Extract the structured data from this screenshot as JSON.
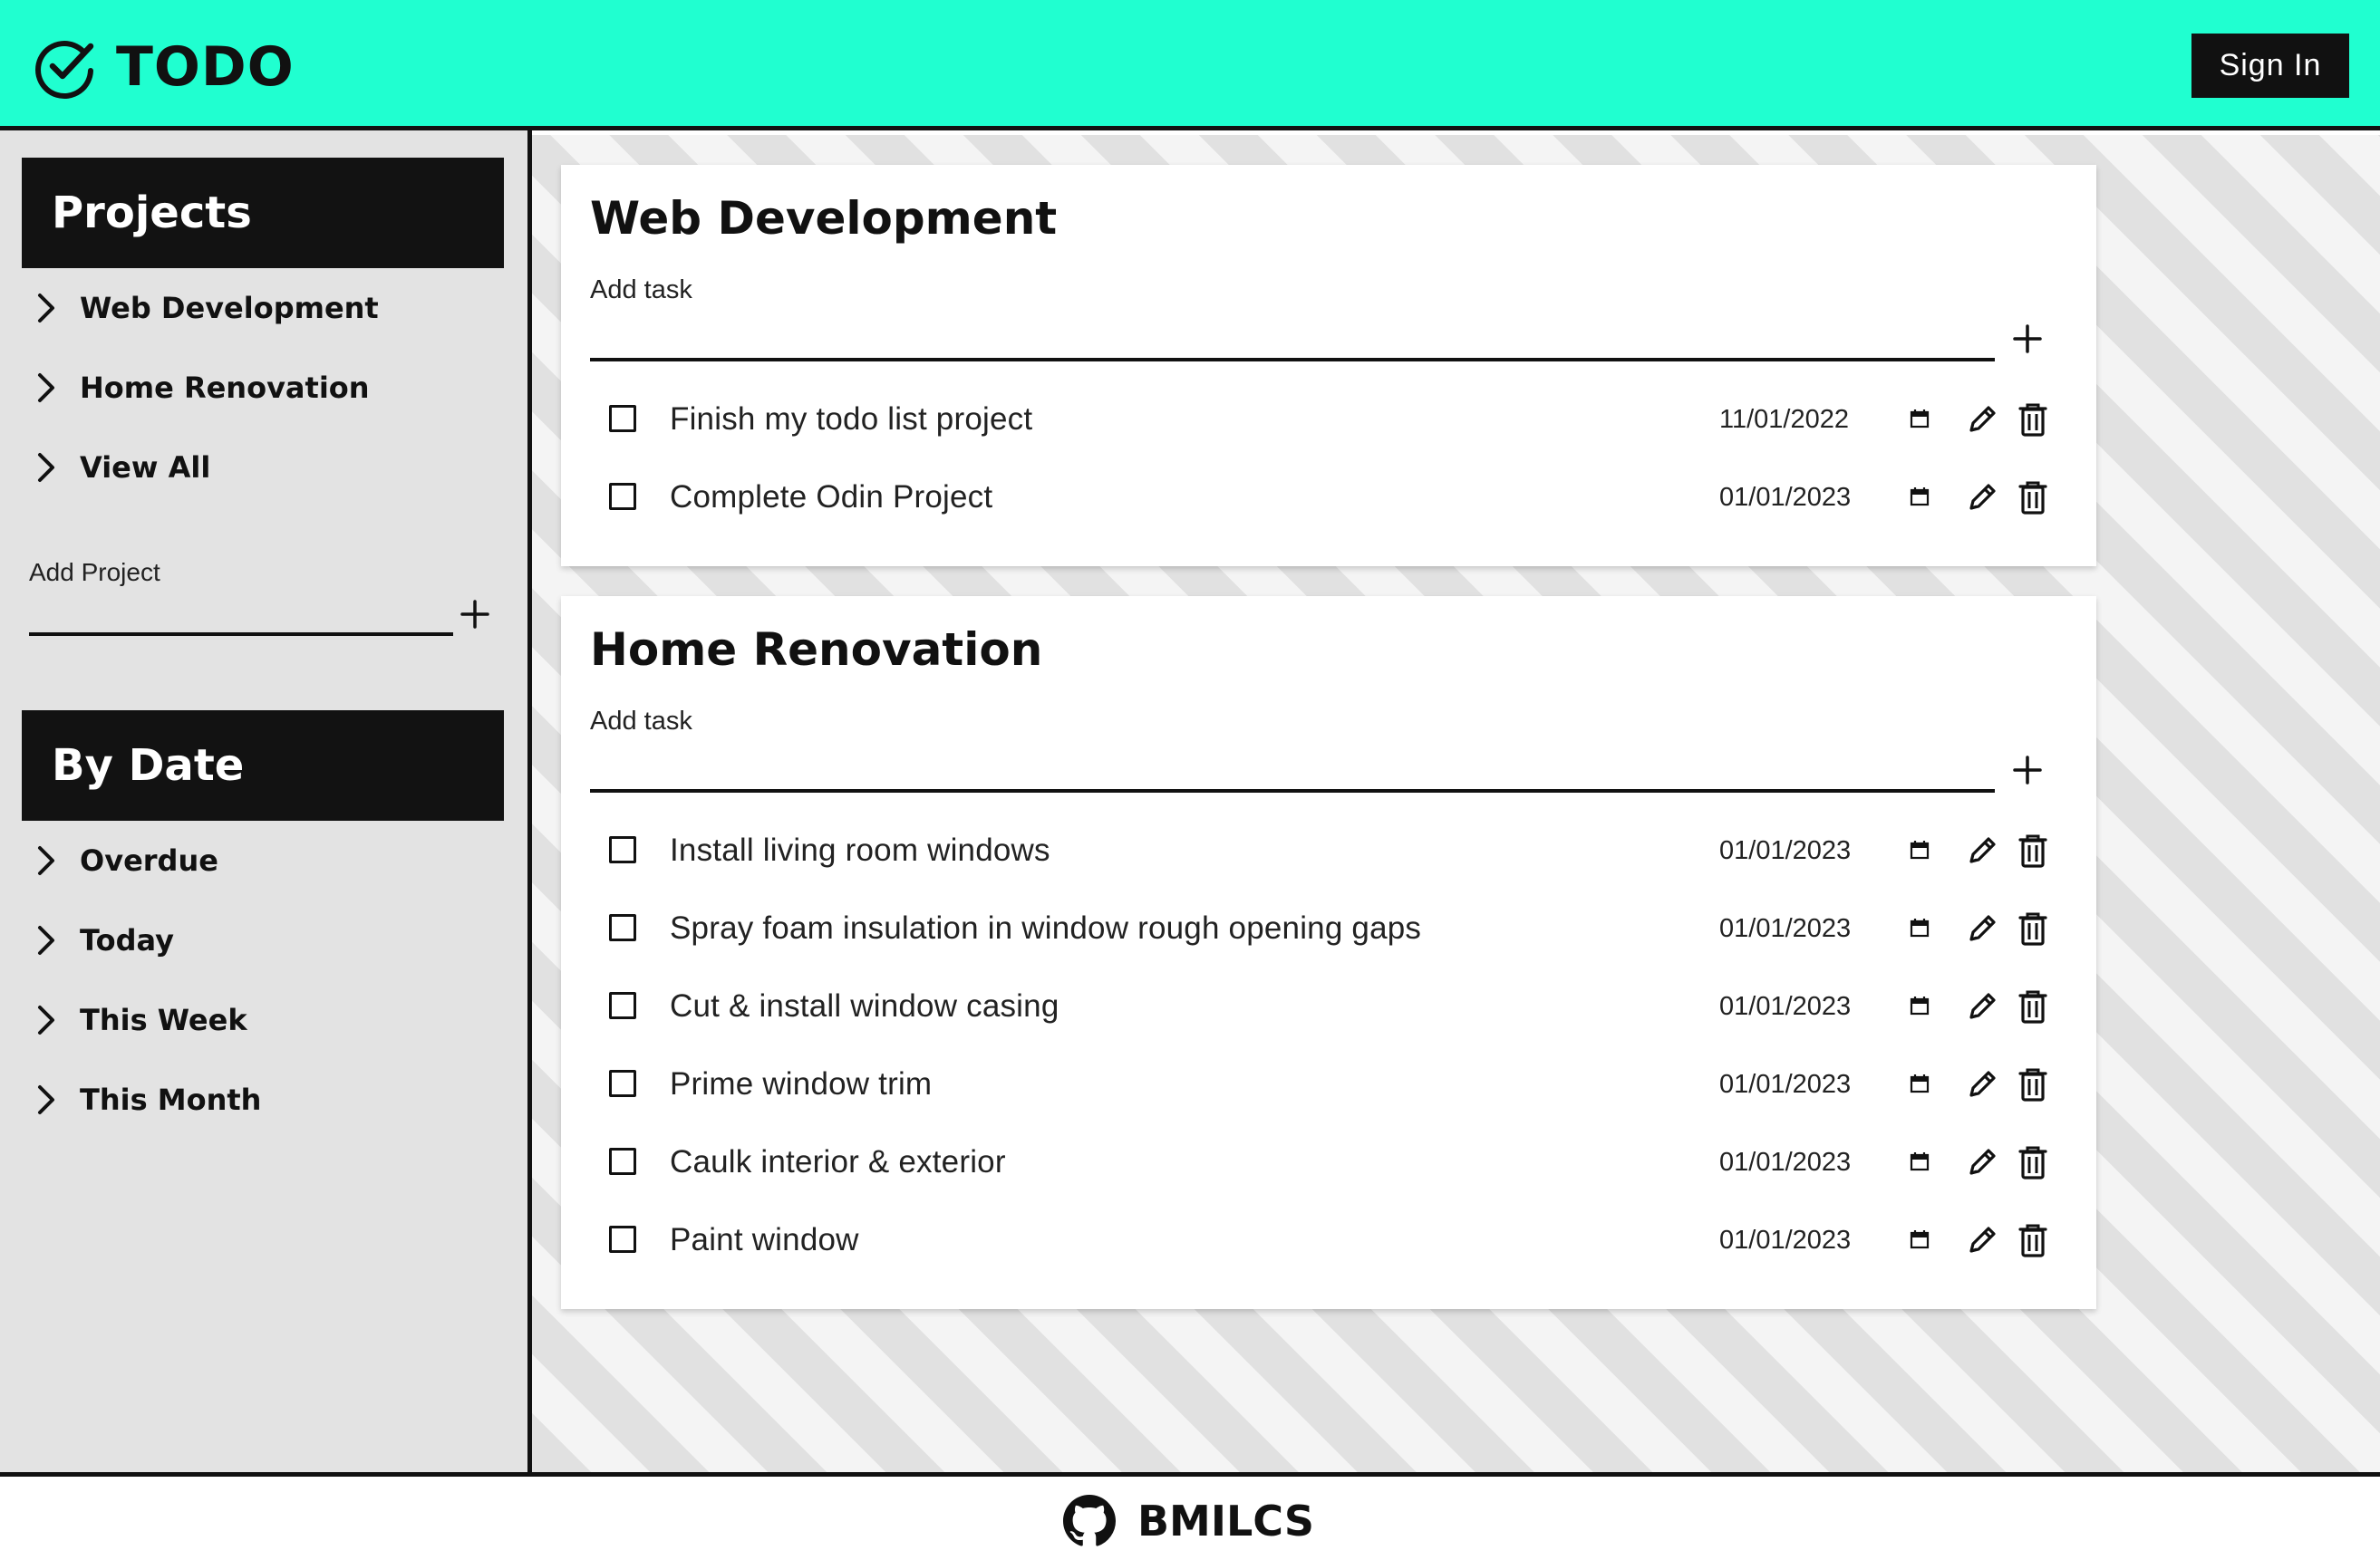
{
  "header": {
    "app_name": "TODO",
    "logo_icon": "check-circle-icon",
    "sign_in_label": "Sign In",
    "accent_color": "#20ffd0"
  },
  "sidebar": {
    "projects_heading": "Projects",
    "project_items": [
      {
        "label": "Web Development",
        "icon": "chevron-right-icon"
      },
      {
        "label": "Home Renovation",
        "icon": "chevron-right-icon"
      },
      {
        "label": "View All",
        "icon": "chevron-right-icon"
      }
    ],
    "add_project_label": "Add Project",
    "add_project_value": "",
    "by_date_heading": "By Date",
    "date_items": [
      {
        "label": "Overdue",
        "icon": "chevron-right-icon"
      },
      {
        "label": "Today",
        "icon": "chevron-right-icon"
      },
      {
        "label": "This Week",
        "icon": "chevron-right-icon"
      },
      {
        "label": "This Month",
        "icon": "chevron-right-icon"
      }
    ]
  },
  "projects": [
    {
      "title": "Web Development",
      "add_task_label": "Add task",
      "add_task_value": "",
      "tasks": [
        {
          "text": "Finish my todo list project",
          "date": "11/01/2022",
          "done": false
        },
        {
          "text": "Complete Odin Project",
          "date": "01/01/2023",
          "done": false
        }
      ]
    },
    {
      "title": "Home Renovation",
      "add_task_label": "Add task",
      "add_task_value": "",
      "tasks": [
        {
          "text": "Install living room windows",
          "date": "01/01/2023",
          "done": false
        },
        {
          "text": "Spray foam insulation in window rough opening gaps",
          "date": "01/01/2023",
          "done": false
        },
        {
          "text": "Cut & install window casing",
          "date": "01/01/2023",
          "done": false
        },
        {
          "text": "Prime window trim",
          "date": "01/01/2023",
          "done": false
        },
        {
          "text": "Caulk interior & exterior",
          "date": "01/01/2023",
          "done": false
        },
        {
          "text": "Paint window",
          "date": "01/01/2023",
          "done": false
        }
      ]
    }
  ],
  "footer": {
    "label": "BMILCS",
    "icon": "github-icon"
  }
}
